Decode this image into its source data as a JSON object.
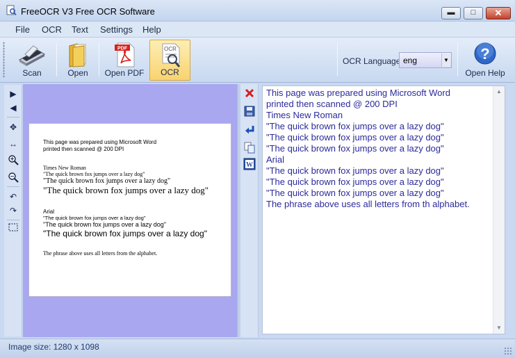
{
  "window": {
    "title": "FreeOCR V3 Free OCR Software",
    "controls": {
      "minimize": "▬",
      "maximize": "□",
      "close": "✕"
    }
  },
  "menu": [
    "File",
    "OCR",
    "Text",
    "Settings",
    "Help"
  ],
  "toolbar": {
    "scan_label": "Scan",
    "open_label": "Open",
    "open_pdf_label": "Open PDF",
    "ocr_label": "OCR",
    "language_label": "OCR Language:",
    "language_value": "eng",
    "help_label": "Open Help"
  },
  "left_tools": [
    "play-right-icon",
    "play-left-icon",
    "move-icon",
    "fit-width-icon",
    "zoom-in-icon",
    "zoom-out-icon",
    "rotate-left-icon",
    "rotate-right-icon",
    "select-area-icon"
  ],
  "text_tools": [
    "clear-icon",
    "save-icon",
    "paste-icon",
    "copy-icon",
    "word-icon"
  ],
  "document_preview": {
    "line1": "This page was prepared using Microsoft Word",
    "line2": "printed then scanned @ 200 DPI",
    "times_heading": "Times New Roman",
    "times_small": "\"The quick brown fox jumps over a lazy dog\"",
    "times_medium": "\"The quick brown fox jumps over a lazy dog\"",
    "times_large": "\"The quick brown fox jumps over a lazy dog\"",
    "arial_heading": "Arial",
    "arial_small": "\"The quick brown fox jumps over a lazy dog\"",
    "arial_medium": "\"The quick brown fox  jumps over a lazy dog\"",
    "arial_large": "\"The quick brown fox jumps over a lazy dog\"",
    "footer": "The phrase above uses all letters from the alphabet."
  },
  "ocr_text": [
    "This page was prepared using Microsoft Word",
    "printed then scanned @ 200 DPI",
    "Times New Roman",
    "\"The quick brown fox jumps over a lazy dog\"",
    "\"The quick brown fox jumps over a lazy dog\"",
    "\"The quick brown fox jumps over a lazy dog\"",
    "Arial",
    "\"The quick brown fox jumps over a lazy dog\"",
    "\"The quick brown fox jumps over a lazy dog\"",
    "\"The quick brown fox jumps over a lazy dog\"",
    "The phrase above uses all letters from th alphabet."
  ],
  "status": {
    "image_size": "Image size:  1280 x 1098"
  },
  "colors": {
    "image_bg": "#a8a7f0",
    "ocr_text": "#2b2a9a",
    "ocr_active": "#f9d36f"
  }
}
